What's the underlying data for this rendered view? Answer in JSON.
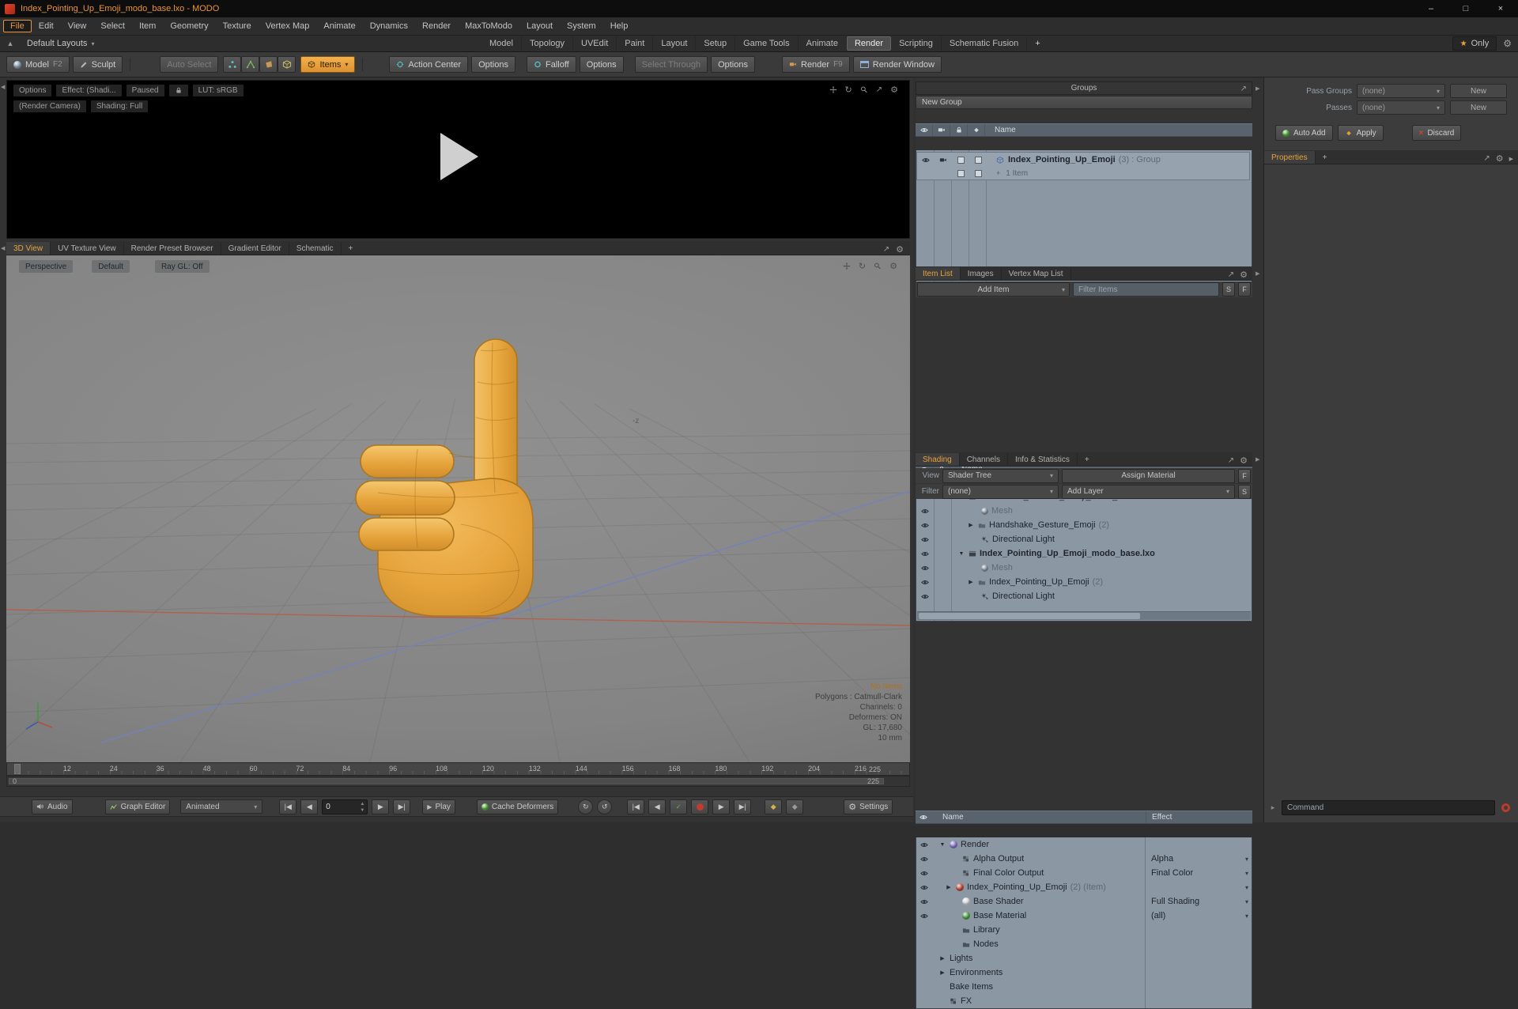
{
  "colors": {
    "accent": "#e8a23c",
    "panel_bg": "#3c3c3c",
    "tree_bg": "#8b97a3",
    "viewport_bg": "#868686",
    "hand": "#e8a640",
    "alert_red": "#c23b2e"
  },
  "titlebar": {
    "title": "Index_Pointing_Up_Emoji_modo_base.lxo - MODO",
    "minimize": "–",
    "maximize": "□",
    "close": "×"
  },
  "menubar": {
    "items": [
      "File",
      "Edit",
      "View",
      "Select",
      "Item",
      "Geometry",
      "Texture",
      "Vertex Map",
      "Animate",
      "Dynamics",
      "Render",
      "MaxToModo",
      "Layout",
      "System",
      "Help"
    ]
  },
  "layoutbar": {
    "switcher": "Default Layouts",
    "tabs": [
      "Model",
      "Topology",
      "UVEdit",
      "Paint",
      "Layout",
      "Setup",
      "Game Tools",
      "Animate",
      "Render",
      "Scripting",
      "Schematic Fusion"
    ],
    "add_tab": "+",
    "only": "Only"
  },
  "toolbar": {
    "model": "Model",
    "model_key": "F2",
    "sculpt": "Sculpt",
    "auto_select": "Auto Select",
    "items": "Items",
    "action_center": "Action Center",
    "options": "Options",
    "falloff": "Falloff",
    "select_through": "Select Through",
    "render": "Render",
    "render_key": "F9",
    "render_window": "Render Window"
  },
  "preview": {
    "options": "Options",
    "effect": "Effect: (Shadi...",
    "paused": "Paused",
    "lut": "LUT: sRGB",
    "camera": "(Render Camera)",
    "shading": "Shading: Full"
  },
  "viewport_tabs": {
    "tabs": [
      "3D View",
      "UV Texture View",
      "Render Preset Browser",
      "Gradient Editor",
      "Schematic"
    ],
    "add": "+"
  },
  "viewport": {
    "perspective": "Perspective",
    "default": "Default",
    "raygl": "Ray GL: Off",
    "axis_label": "-z",
    "info": {
      "no_items": "No Items",
      "polygons": "Polygons : Catmull-Clark",
      "channels": "Channels: 0",
      "deformers": "Deformers: ON",
      "gl": "GL: 17,680",
      "scale": "10 mm"
    }
  },
  "timeline": {
    "ticks": [
      "0",
      "12",
      "24",
      "36",
      "48",
      "60",
      "72",
      "84",
      "96",
      "108",
      "120",
      "132",
      "144",
      "156",
      "168",
      "180",
      "192",
      "204",
      "216"
    ],
    "end": "225",
    "range_start": "0",
    "range_end": "225"
  },
  "transport": {
    "audio": "Audio",
    "graph_editor": "Graph Editor",
    "mode": "Animated",
    "frame": "0",
    "play": "Play",
    "cache_deformers": "Cache Deformers",
    "settings": "Settings"
  },
  "groups": {
    "title": "Groups",
    "new_group": "New Group",
    "name_header": "Name",
    "group_name": "Index_Pointing_Up_Emoji",
    "group_suffix": "(3) : Group",
    "sub_item": "1 Item"
  },
  "item_list": {
    "tabs": [
      "Item List",
      "Images",
      "Vertex Map List"
    ],
    "add_item": "Add Item",
    "filter_placeholder": "Filter Items",
    "s": "S",
    "f": "F",
    "name_header": "Name",
    "rows": [
      {
        "label": "Handshake_Gesture_Emoji_modo_base.lxo",
        "suffix": ""
      },
      {
        "label": "Mesh",
        "suffix": ""
      },
      {
        "label": "Handshake_Gesture_Emoji",
        "suffix": "(2)"
      },
      {
        "label": "Directional Light",
        "suffix": ""
      },
      {
        "label": "Index_Pointing_Up_Emoji_modo_base.lxo",
        "suffix": ""
      },
      {
        "label": "Mesh",
        "suffix": ""
      },
      {
        "label": "Index_Pointing_Up_Emoji",
        "suffix": "(2)"
      },
      {
        "label": "Directional Light",
        "suffix": ""
      }
    ]
  },
  "shading": {
    "tabs": [
      "Shading",
      "Channels",
      "Info & Statistics"
    ],
    "add": "+",
    "view_label": "View",
    "view_value": "Shader Tree",
    "assign_material": "Assign Material",
    "f": "F",
    "filter_label": "Filter",
    "filter_value": "(none)",
    "add_layer": "Add Layer",
    "s": "S",
    "name_header": "Name",
    "effect_header": "Effect",
    "rows": [
      {
        "label": "Render",
        "suffix": "",
        "effect": ""
      },
      {
        "label": "Alpha Output",
        "suffix": "",
        "effect": "Alpha"
      },
      {
        "label": "Final Color Output",
        "suffix": "",
        "effect": "Final Color"
      },
      {
        "label": "Index_Pointing_Up_Emoji",
        "suffix": "(2) (Item)",
        "effect": ""
      },
      {
        "label": "Base Shader",
        "suffix": "",
        "effect": "Full Shading"
      },
      {
        "label": "Base Material",
        "suffix": "",
        "effect": "(all)"
      },
      {
        "label": "Library",
        "suffix": "",
        "effect": ""
      },
      {
        "label": "Nodes",
        "suffix": "",
        "effect": ""
      },
      {
        "label": "Lights",
        "suffix": "",
        "effect": ""
      },
      {
        "label": "Environments",
        "suffix": "",
        "effect": ""
      },
      {
        "label": "Bake Items",
        "suffix": "",
        "effect": ""
      },
      {
        "label": "FX",
        "suffix": "",
        "effect": ""
      }
    ]
  },
  "right_panel": {
    "pass_groups": "Pass Groups",
    "passes": "Passes",
    "none": "(none)",
    "new": "New",
    "auto_add": "Auto Add",
    "apply": "Apply",
    "discard": "Discard",
    "properties": "Properties",
    "add_tab": "+",
    "command_placeholder": "Command"
  }
}
